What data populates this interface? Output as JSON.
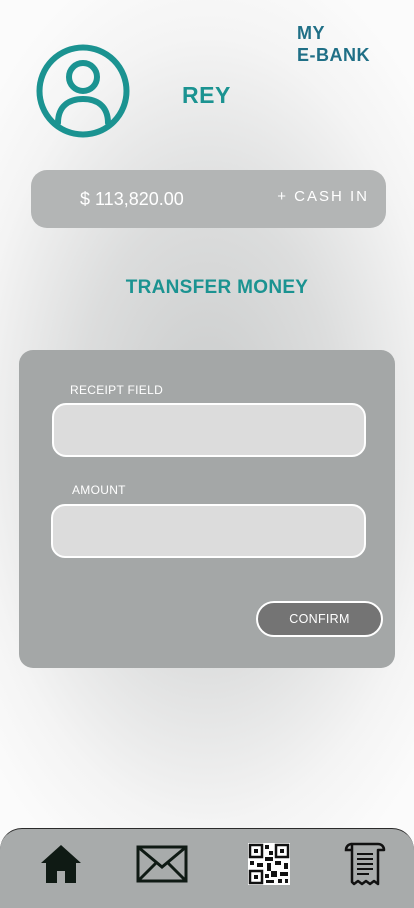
{
  "app": {
    "brand": "MY\nE-BANK"
  },
  "user": {
    "name": "REY",
    "avatar_icon": "user-avatar-icon"
  },
  "balance": {
    "amount": "$ 113,820.00",
    "cash_in_label": "+ CASH IN"
  },
  "transfer": {
    "title": "TRANSFER MONEY",
    "receipt_label": "RECEIPT FIELD",
    "receipt_value": "",
    "amount_label": "AMOUNT",
    "amount_value": "",
    "confirm_label": "CONFIRM"
  },
  "nav": {
    "items": [
      {
        "icon": "home-icon"
      },
      {
        "icon": "mail-icon"
      },
      {
        "icon": "qr-code-icon"
      },
      {
        "icon": "receipt-icon"
      }
    ]
  },
  "colors": {
    "accent_teal": "#1b9391",
    "brand_blue": "#1f6f86",
    "card_gray": "#b3b5b5",
    "form_gray": "#a4a7a7",
    "button_dark": "#747474"
  }
}
